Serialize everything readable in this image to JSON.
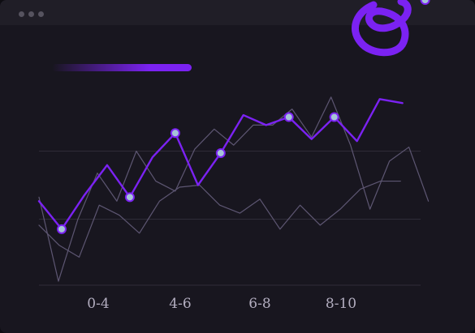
{
  "colors": {
    "background": "#18161f",
    "titlebar": "#201e27",
    "accent": "#7b22f2",
    "marker_fill": "#a6c4d8",
    "secondary_lines": "#5d5672",
    "grid": "#2f2c38",
    "tick_text": "#b3aec0"
  },
  "window": {
    "controls": [
      "dot",
      "dot",
      "dot"
    ]
  },
  "decoration": {
    "scribble_icon": "scribble-icon",
    "accent_bar": "accent-bar"
  },
  "chart_data": {
    "type": "line",
    "categories": [
      "0-4",
      "4-6",
      "6-8",
      "8-10"
    ],
    "x_range": [
      0,
      19
    ],
    "ylim": [
      0,
      100
    ],
    "grid": "horizontal",
    "series": [
      {
        "values": [
          42,
          28,
          45,
          60,
          44,
          64,
          76,
          50,
          66,
          85,
          80,
          84,
          73,
          84,
          72,
          93,
          91
        ],
        "markers": [
          1,
          4,
          6,
          8,
          11,
          13,
          17
        ]
      },
      {
        "values": [
          30,
          20,
          14,
          40,
          35,
          26,
          42,
          49,
          50,
          40,
          36,
          43,
          28,
          40,
          30,
          38,
          48,
          52,
          52
        ]
      },
      {
        "values": [
          44,
          2,
          33,
          56,
          42,
          67,
          52,
          47,
          68,
          78,
          70,
          80,
          80,
          88,
          74,
          94,
          70,
          38,
          62,
          69,
          42
        ]
      }
    ]
  }
}
